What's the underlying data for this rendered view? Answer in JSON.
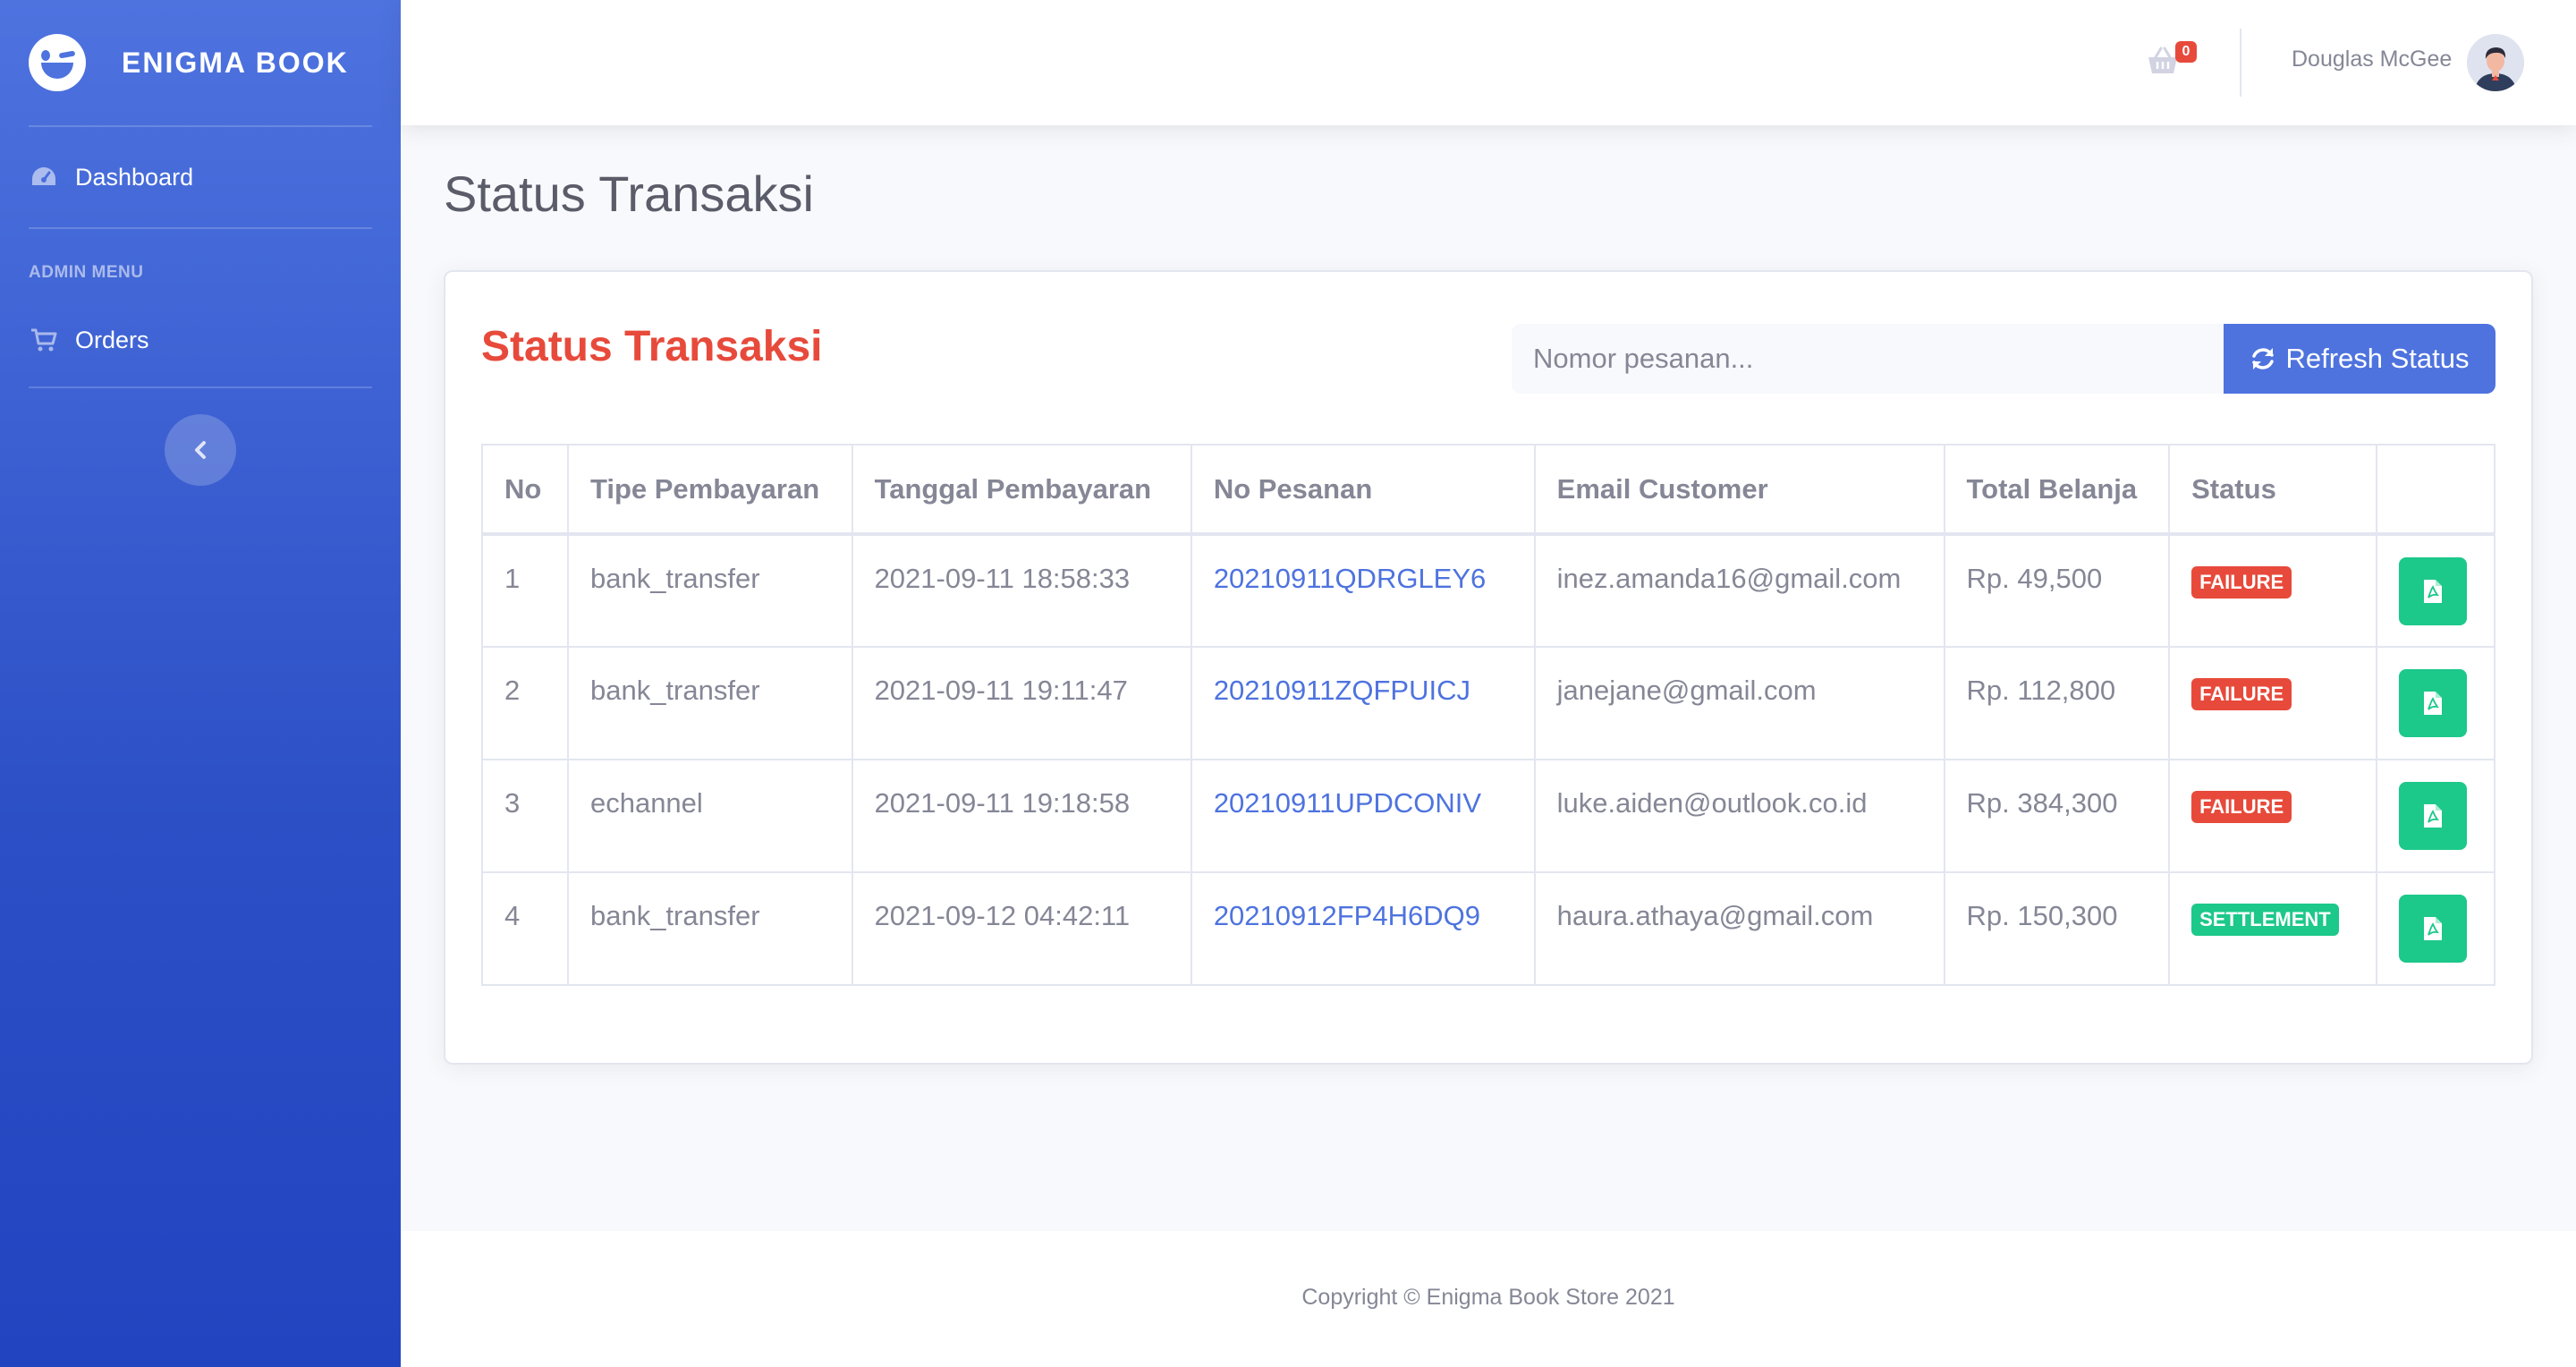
{
  "brand": {
    "name": "ENIGMA BOOK"
  },
  "sidebar": {
    "items": [
      {
        "label": "Dashboard",
        "icon": "tachometer-icon"
      },
      {
        "label": "Orders",
        "icon": "cart-icon"
      }
    ],
    "heading": "ADMIN MENU"
  },
  "topbar": {
    "cart_count": "0",
    "user_name": "Douglas McGee"
  },
  "page": {
    "title": "Status Transaksi"
  },
  "card": {
    "title": "Status Transaksi",
    "search_placeholder": "Nomor pesanan...",
    "refresh_label": "Refresh Status"
  },
  "table": {
    "headers": [
      "No",
      "Tipe Pembayaran",
      "Tanggal Pembayaran",
      "No Pesanan",
      "Email Customer",
      "Total Belanja",
      "Status",
      ""
    ],
    "rows": [
      {
        "no": "1",
        "tipe": "bank_transfer",
        "tanggal": "2021-09-11 18:58:33",
        "pesanan": "20210911QDRGLEY6",
        "email": "inez.amanda16@gmail.com",
        "total": "Rp. 49,500",
        "status": "FAILURE"
      },
      {
        "no": "2",
        "tipe": "bank_transfer",
        "tanggal": "2021-09-11 19:11:47",
        "pesanan": "20210911ZQFPUICJ",
        "email": "janejane@gmail.com",
        "total": "Rp. 112,800",
        "status": "FAILURE"
      },
      {
        "no": "3",
        "tipe": "echannel",
        "tanggal": "2021-09-11 19:18:58",
        "pesanan": "20210911UPDCONIV",
        "email": "luke.aiden@outlook.co.id",
        "total": "Rp. 384,300",
        "status": "FAILURE"
      },
      {
        "no": "4",
        "tipe": "bank_transfer",
        "tanggal": "2021-09-12 04:42:11",
        "pesanan": "20210912FP4H6DQ9",
        "email": "haura.athaya@gmail.com",
        "total": "Rp. 150,300",
        "status": "SETTLEMENT"
      }
    ]
  },
  "footer": {
    "copyright": "Copyright © Enigma Book Store 2021"
  },
  "colors": {
    "primary": "#4e73df",
    "danger": "#e74a3b",
    "success": "#1cc88a",
    "text": "#858796"
  }
}
